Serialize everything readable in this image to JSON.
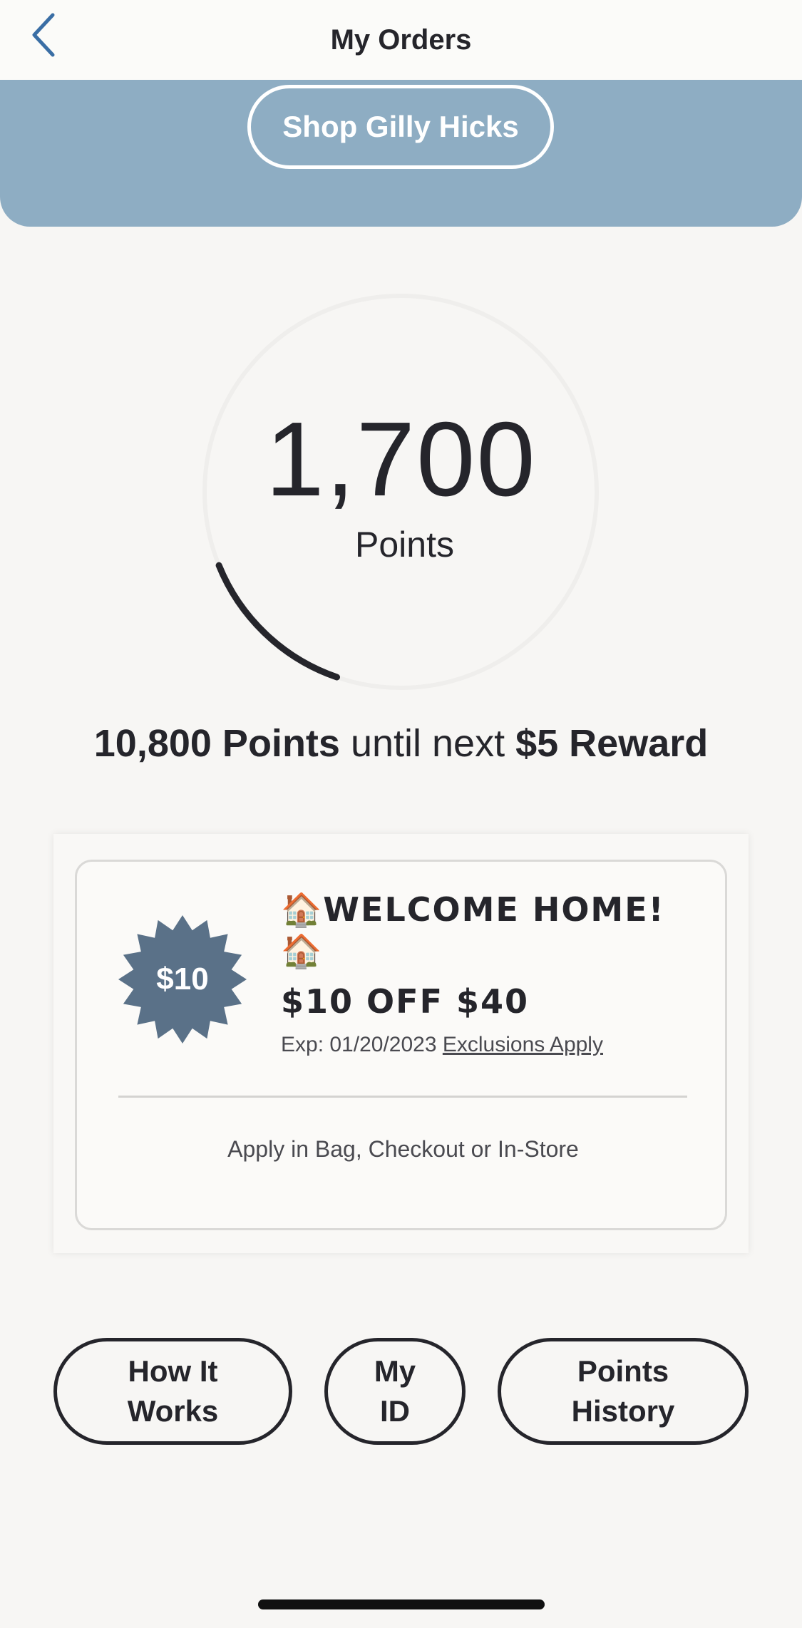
{
  "header": {
    "title": "My Orders",
    "back_icon": "chevron-left-icon"
  },
  "banner": {
    "shop_button_label": "Shop Gilly Hicks"
  },
  "points": {
    "value": "1,700",
    "label": "Points",
    "progress_fraction": 0.136
  },
  "next_reward": {
    "points_needed": "10,800 Points",
    "middle_text": " until next ",
    "reward": "$5 Reward"
  },
  "offer": {
    "badge_text": "$10",
    "badge_color": "#5a7188",
    "title": "🏠WELCOME HOME! 🏠",
    "subtitle": "$10 OFF $40",
    "expiry": "Exp: 01/20/2023 ",
    "exclusions_link": "Exclusions Apply",
    "apply_text": "Apply in Bag, Checkout or In-Store"
  },
  "actions": {
    "how_it_works": "How It Works",
    "my_id": "My ID",
    "points_history": "Points History"
  },
  "colors": {
    "accent": "#3a6ea5",
    "banner": "#8eadc3",
    "text": "#25252b",
    "background": "#f7f6f4"
  }
}
